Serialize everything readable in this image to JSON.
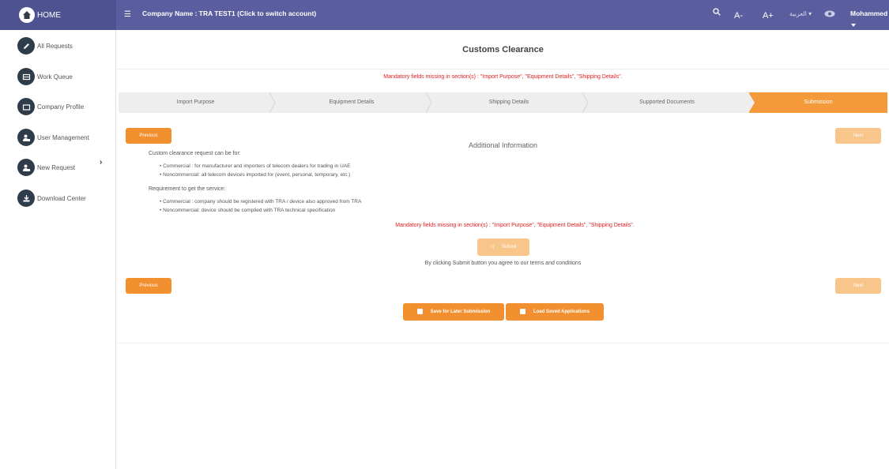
{
  "topbar": {
    "home_label": "HOME",
    "company_label": "Company Name : TRA TEST1 (Click to switch account)",
    "font_decrease": "A-",
    "font_increase": "A+",
    "language": "العربية ▾",
    "user_name": "Mohammed"
  },
  "sidebar": {
    "items": [
      {
        "label": "All Requests",
        "icon": "pencil-icon"
      },
      {
        "label": "Work Queue",
        "icon": "inbox-icon"
      },
      {
        "label": "Company Profile",
        "icon": "folder-icon"
      },
      {
        "label": "User Management",
        "icon": "user-lock-icon"
      },
      {
        "label": "New Request",
        "icon": "user-lock-icon"
      },
      {
        "label": "Download Center",
        "icon": "download-icon"
      }
    ],
    "expand_chevron": "›"
  },
  "main": {
    "title": "Customs Clearance",
    "alert": "Mandatory fields missing in section(s) : \"Import Purpose\", \"Equipment Details\", \"Shipping Details\".",
    "steps": [
      {
        "label": "Import Purpose",
        "active": false
      },
      {
        "label": "Equipment Details",
        "active": false
      },
      {
        "label": "Shipping Details",
        "active": false
      },
      {
        "label": "Supported Documents",
        "active": false
      },
      {
        "label": "Submission",
        "active": true
      }
    ],
    "previous_label": "Previous",
    "next_label": "Next",
    "section_title": "Additional Information",
    "intro": "Custom clearance request can be for:",
    "for_bullets": [
      "Commercial : for manufacturer and importers of telecom dealers for trading in UAE",
      "Noncommercial: all telecom devices imported for (event, personal, temporary, etc.)"
    ],
    "requirement_title": "Requirement to get the service:",
    "requirement_bullets": [
      "Commercial : company should be registered with TRA / device also approved from TRA",
      "Noncommercial: device should be complied with TRA technical specification"
    ],
    "submit_label": "Submit",
    "agree_text": "By clicking Submit button you agree to our terms and conditions",
    "save_later_label": "Save for Later Submission",
    "load_saved_label": "Load Saved Applications"
  },
  "colors": {
    "topbar": "#5b5e9e",
    "accent": "#f28f2f",
    "accent_light": "#f8c58a",
    "alert": "#e02020",
    "sidebar_icon": "#2f3d4a"
  }
}
